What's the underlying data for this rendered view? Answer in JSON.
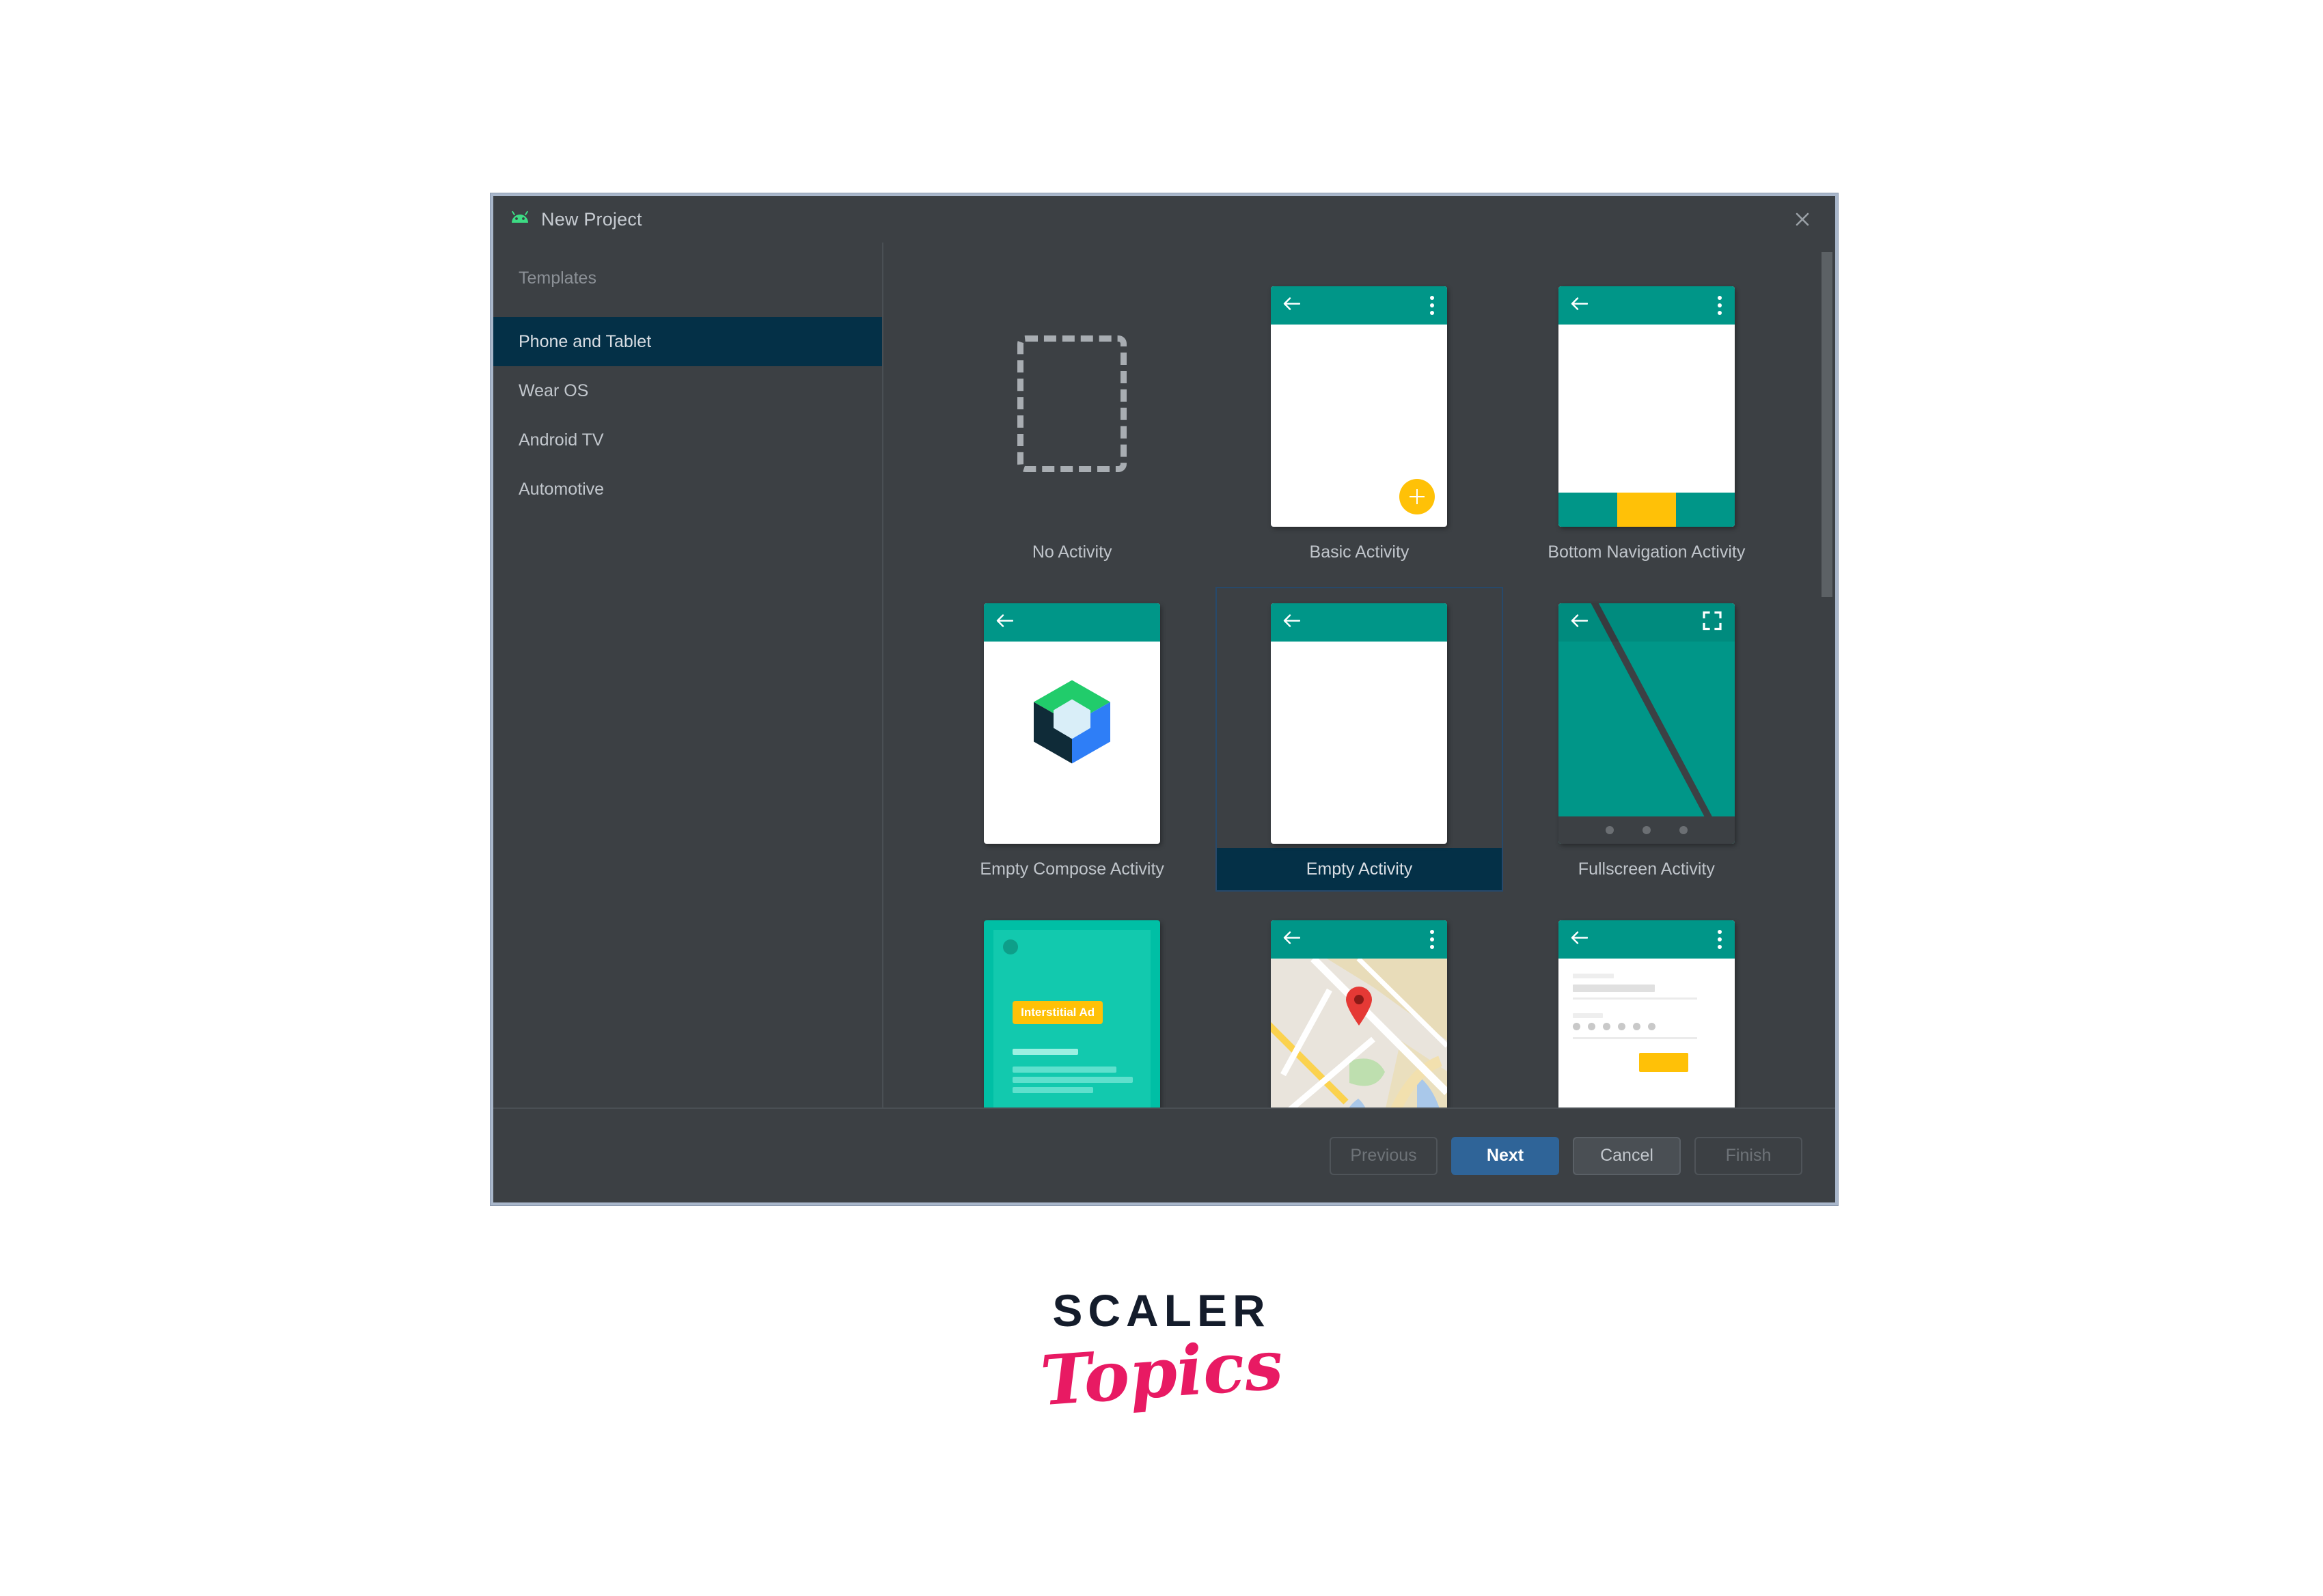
{
  "window": {
    "title": "New Project",
    "app_icon": "android-robot-icon",
    "close_icon": "close-icon"
  },
  "sidebar": {
    "header": "Templates",
    "items": [
      {
        "label": "Phone and Tablet",
        "selected": true
      },
      {
        "label": "Wear OS",
        "selected": false
      },
      {
        "label": "Android TV",
        "selected": false
      },
      {
        "label": "Automotive",
        "selected": false
      }
    ]
  },
  "templates": [
    {
      "label": "No Activity",
      "kind": "no-activity",
      "selected": false
    },
    {
      "label": "Basic Activity",
      "kind": "basic-activity",
      "selected": false
    },
    {
      "label": "Bottom Navigation Activity",
      "kind": "bottom-navigation",
      "selected": false
    },
    {
      "label": "Empty Compose Activity",
      "kind": "empty-compose",
      "selected": false
    },
    {
      "label": "Empty Activity",
      "kind": "empty-activity",
      "selected": true
    },
    {
      "label": "Fullscreen Activity",
      "kind": "fullscreen",
      "selected": false
    },
    {
      "label": "",
      "kind": "interstitial-ad",
      "selected": false
    },
    {
      "label": "",
      "kind": "google-maps",
      "selected": false
    },
    {
      "label": "",
      "kind": "login",
      "selected": false
    }
  ],
  "interstitial": {
    "badge": "Interstitial Ad"
  },
  "footer": {
    "previous": "Previous",
    "next": "Next",
    "cancel": "Cancel",
    "finish": "Finish"
  },
  "brand": {
    "name": "SCALER",
    "sub": "Topics"
  },
  "colors": {
    "dialog_bg": "#3c4044",
    "dialog_border": "#a9b7cb",
    "selection_blue": "#043047",
    "selection_border": "#27496b",
    "primary_button": "#2f6498",
    "android_green": "#3ddc84",
    "material_teal": "#009688",
    "material_amber": "#ffc107",
    "brand_navy": "#141c2b",
    "brand_pink": "#e81a63"
  }
}
